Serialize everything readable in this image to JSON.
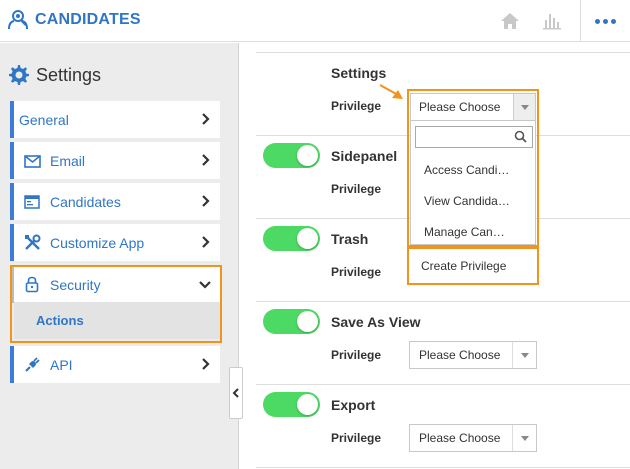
{
  "header": {
    "title": "CANDIDATES",
    "icons": [
      "candidates-logo-icon",
      "home-icon",
      "chart-icon",
      "more-icon"
    ]
  },
  "sidebar": {
    "title": "Settings",
    "items": [
      {
        "label": "General",
        "icon": ""
      },
      {
        "label": "Email",
        "icon": "envelope-icon"
      },
      {
        "label": "Candidates",
        "icon": "window-icon"
      },
      {
        "label": "Customize App",
        "icon": "tools-icon"
      },
      {
        "label": "Security",
        "icon": "lock-icon",
        "expanded": true
      },
      {
        "label": "API",
        "icon": "plug-icon"
      }
    ],
    "subitem": {
      "label": "Actions"
    }
  },
  "main": {
    "sections": [
      {
        "title": "Settings",
        "privilege_label": "Privilege",
        "select_value": "Please Choose",
        "toggle": null
      },
      {
        "title": "Sidepanel",
        "privilege_label": "Privilege",
        "select_value": "",
        "toggle": true
      },
      {
        "title": "Trash",
        "privilege_label": "Privilege",
        "select_value": "",
        "toggle": true
      },
      {
        "title": "Save As View",
        "privilege_label": "Privilege",
        "select_value": "Please Choose",
        "toggle": true
      },
      {
        "title": "Export",
        "privilege_label": "Privilege",
        "select_value": "Please Choose",
        "toggle": true
      }
    ],
    "dropdown": {
      "options": [
        "Access Candi…",
        "View Candida…",
        "Manage Can…"
      ],
      "create_label": "Create Privilege"
    }
  },
  "colors": {
    "accent": "#2f76c6",
    "highlight": "#f0941e",
    "toggle_on": "#4cd964"
  }
}
